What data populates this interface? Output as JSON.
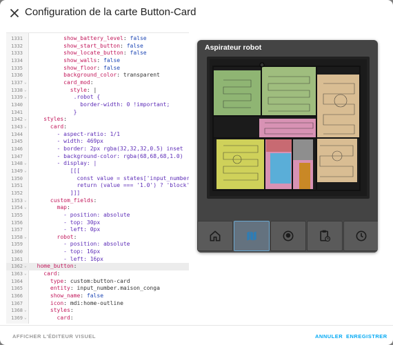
{
  "dialog": {
    "title": "Configuration de la carte Button-Card",
    "close_icon": "close-icon"
  },
  "editor": {
    "lines": [
      {
        "n": "1331",
        "fold": "",
        "indent": "          ",
        "k": "show_battery_level",
        "v": "false",
        "vc": "b"
      },
      {
        "n": "1332",
        "fold": "",
        "indent": "          ",
        "k": "show_start_button",
        "v": "false",
        "vc": "b"
      },
      {
        "n": "1333",
        "fold": "",
        "indent": "          ",
        "k": "show_locate_button",
        "v": "false",
        "vc": "b"
      },
      {
        "n": "1334",
        "fold": "",
        "indent": "          ",
        "k": "show_walls",
        "v": "false",
        "vc": "b"
      },
      {
        "n": "1335",
        "fold": "",
        "indent": "          ",
        "k": "show_floor",
        "v": "false",
        "vc": "b"
      },
      {
        "n": "1336",
        "fold": "",
        "indent": "          ",
        "k": "background_color",
        "v": "transparent",
        "vc": ""
      },
      {
        "n": "1337",
        "fold": "⌄",
        "indent": "          ",
        "k": "card_mod",
        "v": "",
        "vc": ""
      },
      {
        "n": "1338",
        "fold": "⌄",
        "indent": "            ",
        "k": "style",
        "v": "|",
        "vc": ""
      },
      {
        "n": "1339",
        "fold": "⌄",
        "indent": "             ",
        "k": "",
        "v": ".robot {",
        "vc": "s"
      },
      {
        "n": "1340",
        "fold": "",
        "indent": "               ",
        "k": "",
        "v": "border-width: 0 !important;",
        "vc": "s"
      },
      {
        "n": "1341",
        "fold": "",
        "indent": "             ",
        "k": "",
        "v": "}",
        "vc": "s"
      },
      {
        "n": "1342",
        "fold": "⌄",
        "indent": "    ",
        "k": "styles",
        "v": "",
        "vc": ""
      },
      {
        "n": "1343",
        "fold": "⌄",
        "indent": "      ",
        "k": "card",
        "v": "",
        "vc": ""
      },
      {
        "n": "1344",
        "fold": "",
        "indent": "        ",
        "k": "",
        "v": "- aspect-ratio: 1/1",
        "vc": "s"
      },
      {
        "n": "1345",
        "fold": "",
        "indent": "        ",
        "k": "",
        "v": "- width: 469px",
        "vc": "s"
      },
      {
        "n": "1346",
        "fold": "",
        "indent": "        ",
        "k": "",
        "v": "- border: 2px rgba(32,32,32,0.5) inset",
        "vc": "s"
      },
      {
        "n": "1347",
        "fold": "",
        "indent": "        ",
        "k": "",
        "v": "- background-color: rgba(68,68,68,1.0)",
        "vc": "s"
      },
      {
        "n": "1348",
        "fold": "⌄",
        "indent": "        ",
        "k": "",
        "v": "- display: |",
        "vc": "s"
      },
      {
        "n": "1349",
        "fold": "⌄",
        "indent": "            ",
        "k": "",
        "v": "[[[",
        "vc": "s"
      },
      {
        "n": "1350",
        "fold": "",
        "indent": "              ",
        "k": "",
        "v": "const value = states['input_number.",
        "vc": "s"
      },
      {
        "n": "1351",
        "fold": "",
        "indent": "              ",
        "k": "",
        "v": "return (value === '1.0') ? 'block'",
        "vc": "s"
      },
      {
        "n": "1352",
        "fold": "",
        "indent": "            ",
        "k": "",
        "v": "]]]",
        "vc": "s"
      },
      {
        "n": "1353",
        "fold": "⌄",
        "indent": "      ",
        "k": "custom_fields",
        "v": "",
        "vc": ""
      },
      {
        "n": "1354",
        "fold": "⌄",
        "indent": "        ",
        "k": "map",
        "v": "",
        "vc": ""
      },
      {
        "n": "1355",
        "fold": "",
        "indent": "          ",
        "k": "",
        "v": "- position: absolute",
        "vc": "s"
      },
      {
        "n": "1356",
        "fold": "",
        "indent": "          ",
        "k": "",
        "v": "- top: 30px",
        "vc": "s"
      },
      {
        "n": "1357",
        "fold": "",
        "indent": "          ",
        "k": "",
        "v": "- left: 0px",
        "vc": "s"
      },
      {
        "n": "1358",
        "fold": "⌄",
        "indent": "        ",
        "k": "robot",
        "v": "",
        "vc": ""
      },
      {
        "n": "1359",
        "fold": "",
        "indent": "          ",
        "k": "",
        "v": "- position: absolute",
        "vc": "s"
      },
      {
        "n": "1360",
        "fold": "",
        "indent": "          ",
        "k": "",
        "v": "- top: 16px",
        "vc": "s"
      },
      {
        "n": "1361",
        "fold": "",
        "indent": "          ",
        "k": "",
        "v": "- left: 16px",
        "vc": "s"
      },
      {
        "n": "1362",
        "fold": "⌄",
        "indent": "  ",
        "k": "home_button",
        "v": "",
        "vc": "",
        "active": true
      },
      {
        "n": "1363",
        "fold": "⌄",
        "indent": "    ",
        "k": "card",
        "v": "",
        "vc": ""
      },
      {
        "n": "1364",
        "fold": "",
        "indent": "      ",
        "k": "type",
        "v": "custom:button-card",
        "vc": ""
      },
      {
        "n": "1365",
        "fold": "",
        "indent": "      ",
        "k": "entity",
        "v": "input_number.maison_conga",
        "vc": ""
      },
      {
        "n": "1366",
        "fold": "",
        "indent": "      ",
        "k": "show_name",
        "v": "false",
        "vc": "b"
      },
      {
        "n": "1367",
        "fold": "",
        "indent": "      ",
        "k": "icon",
        "v": "mdi:home-outline",
        "vc": ""
      },
      {
        "n": "1368",
        "fold": "⌄",
        "indent": "      ",
        "k": "styles",
        "v": "",
        "vc": ""
      },
      {
        "n": "1369",
        "fold": "⌄",
        "indent": "        ",
        "k": "card",
        "v": "",
        "vc": ""
      }
    ]
  },
  "preview": {
    "card_title": "Aspirateur robot",
    "nav": [
      {
        "icon": "home-outline-icon",
        "active": false
      },
      {
        "icon": "map-icon",
        "active": true
      },
      {
        "icon": "robot-vacuum-icon",
        "active": false
      },
      {
        "icon": "clipboard-clock-icon",
        "active": false
      },
      {
        "icon": "clock-icon",
        "active": false
      }
    ],
    "colors": {
      "active_nav": "#6aa7cf",
      "room_green": "#8fb573",
      "room_yellow": "#cfd15a",
      "room_pink": "#d892b4",
      "room_tan": "#d9bd93",
      "room_blue": "#5aaed8",
      "room_red": "#c86a72",
      "room_orange": "#c98826"
    }
  },
  "footer": {
    "visual_editor": "AFFICHER L'ÉDITEUR VISUEL",
    "cancel": "ANNULER",
    "save": "ENREGISTRER"
  }
}
